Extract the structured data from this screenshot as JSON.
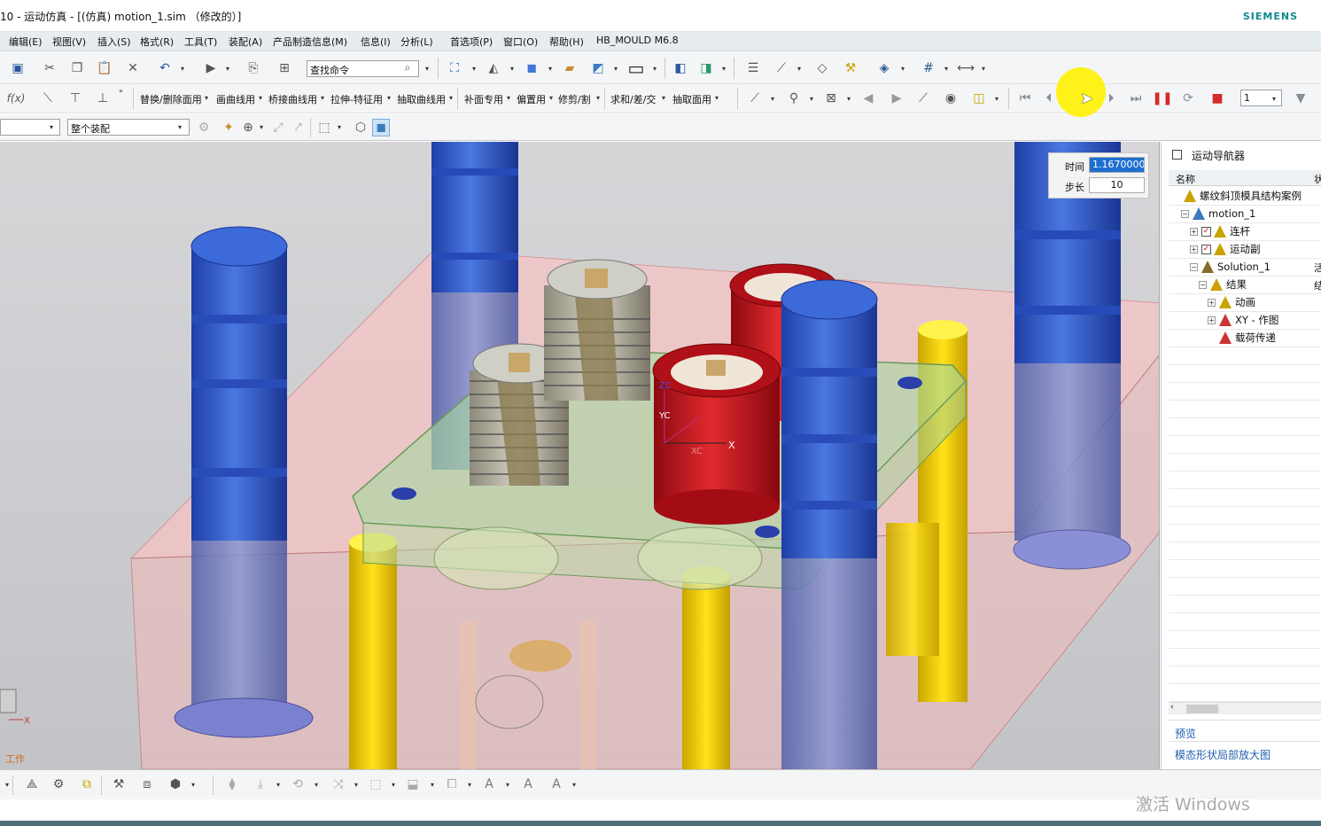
{
  "window": {
    "title": "10 - 运动仿真 - [(仿真) motion_1.sim （修改的）]",
    "brand": "SIEMENS"
  },
  "menu": [
    "编辑(E)",
    "视图(V)",
    "插入(S)",
    "格式(R)",
    "工具(T)",
    "装配(A)",
    "产品制造信息(M)",
    "信息(I)",
    "分析(L)",
    "首选项(P)",
    "窗口(O)",
    "帮助(H)",
    "HB_MOULD M6.8"
  ],
  "toolbar1": {
    "search_placeholder": "查找命令"
  },
  "toolbar2": {
    "fx_label": "f(x)",
    "curve_menus": [
      "替换/删除面用",
      "画曲线用",
      "桥接曲线用",
      "拉伸-特征用",
      "抽取曲线用",
      "补面专用",
      "偏置用",
      "修剪/割",
      "求和/差/交",
      "抽取面用"
    ],
    "step_select": "1"
  },
  "toolbar3": {
    "filter_select": "",
    "assembly_select": "整个装配"
  },
  "timebox": {
    "time_label": "时间",
    "time_value": "1.1670000",
    "step_label": "步长",
    "step_value": "10"
  },
  "navigator": {
    "title": "运动导航器",
    "column_name": "名称",
    "column_other": "状",
    "tree": [
      {
        "label": "螺纹斜顶模具结构案例",
        "level": 0,
        "icon": "assembly-icon",
        "exp": "",
        "chk": false
      },
      {
        "label": "motion_1",
        "level": 1,
        "icon": "motion-icon",
        "exp": "−",
        "chk": false
      },
      {
        "label": "连杆",
        "level": 2,
        "icon": "link-icon",
        "exp": "+",
        "chk": true
      },
      {
        "label": "运动副",
        "level": 2,
        "icon": "joint-icon",
        "exp": "+",
        "chk": true
      },
      {
        "label": "Solution_1",
        "level": 2,
        "icon": "solution-icon",
        "exp": "−",
        "chk": false
      },
      {
        "label": "结果",
        "level": 3,
        "icon": "results-icon",
        "exp": "−",
        "chk": false
      },
      {
        "label": "动画",
        "level": 4,
        "icon": "animation-icon",
        "exp": "+",
        "chk": false
      },
      {
        "label": "XY - 作图",
        "level": 4,
        "icon": "xy-graph-icon",
        "exp": "+",
        "chk": false
      },
      {
        "label": "载荷传递",
        "level": 4,
        "icon": "load-transfer-icon",
        "exp": "",
        "chk": false
      }
    ],
    "side_values": [
      "",
      "",
      "",
      "",
      "活",
      "结",
      "",
      "",
      ""
    ],
    "preview_label": "预览",
    "detail_label": "模态形状局部放大图"
  },
  "viewport": {
    "csys_labels": {
      "zc": "ZC",
      "yc": "YC",
      "xc": "XC",
      "x": "X"
    },
    "work_label": "工作",
    "triad_x": "X"
  },
  "watermark": "激活 Windows",
  "colors": {
    "accent": "#0d8a8f",
    "blue_pillar": "#2f55c8",
    "red_part": "#c4141c",
    "yellow_pin": "#f2d400"
  }
}
